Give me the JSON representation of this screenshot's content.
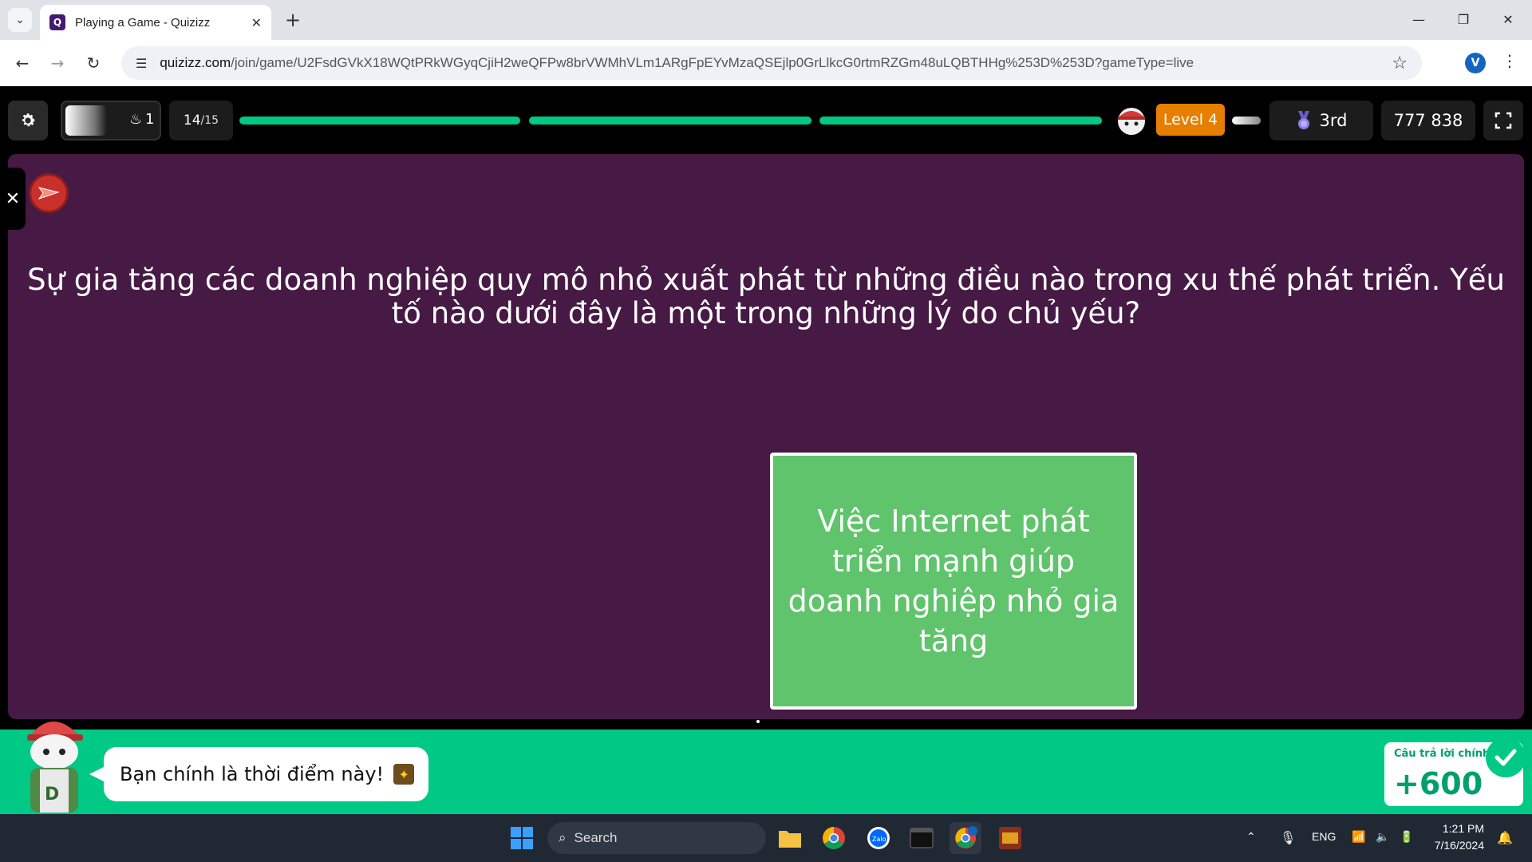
{
  "browser": {
    "tab_title": "Playing a Game - Quizizz",
    "url_host": "quizizz.com",
    "url_path": "/join/game/U2FsdGVkX18WQtPRkWGyqCjiH2weQFPw8brVWMhVLm1ARgFpEYvMzaQSEjlp0GrLlkcG0rtmRZGm48uLQBTHHg%253D%253D?gameType=live",
    "profile_initial": "V"
  },
  "topbar": {
    "streak_count": "1",
    "question_current": "14",
    "question_total": "/15",
    "progress_segments": [
      1.0,
      1.0,
      1.0
    ],
    "level": "Level 4",
    "rank": "3rd",
    "score": "777 838"
  },
  "game": {
    "question": "Sự gia tăng các doanh nghiệp quy mô nhỏ xuất phát từ những điều nào trong xu thế phát triển. Yếu tố nào dưới đây là một trong những lý do chủ yếu?",
    "answer": "Việc Internet phát triển mạnh giúp doanh nghiệp nhỏ gia tăng"
  },
  "feedback": {
    "message": "Bạn chính là thời điểm này!",
    "points_label": "Câu trả lời chính",
    "points_value": "+600",
    "color": "#00c985"
  },
  "taskbar": {
    "search_label": "Search",
    "language": "ENG",
    "time": "1:21 PM",
    "date": "7/16/2024"
  },
  "colors": {
    "game_bg": "#461a44",
    "answer_bg": "#5fc46b",
    "level_badge": "#e67e00",
    "progress": "#00c985"
  }
}
